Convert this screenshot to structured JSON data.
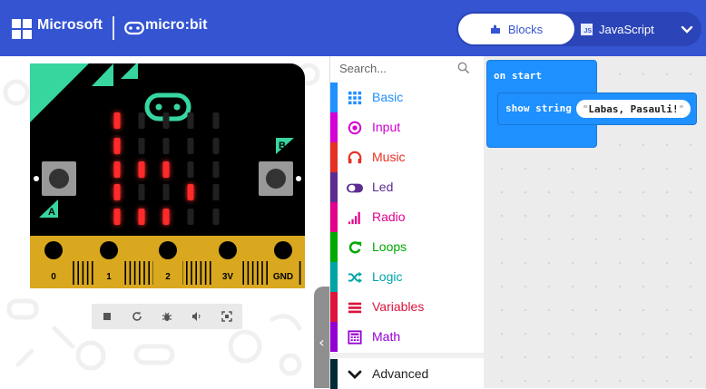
{
  "header": {
    "brand": "Microsoft",
    "product": "micro:bit",
    "tabs": {
      "blocks": "Blocks",
      "javascript": "JavaScript"
    },
    "colors": {
      "bar": "#3454d1"
    }
  },
  "simulator": {
    "pins": [
      "0",
      "1",
      "2",
      "3V",
      "GND"
    ],
    "button_a": "A",
    "button_b": "B",
    "led_rows": [
      [
        1,
        0,
        0,
        0,
        0
      ],
      [
        1,
        0,
        0,
        0,
        0
      ],
      [
        1,
        1,
        1,
        0,
        0
      ],
      [
        1,
        0,
        0,
        1,
        0
      ],
      [
        1,
        1,
        1,
        0,
        0
      ]
    ],
    "toolbar_icons": [
      "stop-icon",
      "restart-icon",
      "debug-icon",
      "sound-icon",
      "fullscreen-icon"
    ]
  },
  "toolbox": {
    "search_placeholder": "Search...",
    "categories": [
      {
        "label": "Basic",
        "color": "#1e90ff",
        "icon": "grid-icon"
      },
      {
        "label": "Input",
        "color": "#d400d4",
        "icon": "target-icon"
      },
      {
        "label": "Music",
        "color": "#e63022",
        "icon": "headphones-icon"
      },
      {
        "label": "Led",
        "color": "#5c2d91",
        "icon": "toggle-icon"
      },
      {
        "label": "Radio",
        "color": "#e3008c",
        "icon": "signal-icon"
      },
      {
        "label": "Loops",
        "color": "#00aa00",
        "icon": "loop-icon"
      },
      {
        "label": "Logic",
        "color": "#00a4a6",
        "icon": "shuffle-icon"
      },
      {
        "label": "Variables",
        "color": "#dc143c",
        "icon": "lines-icon"
      },
      {
        "label": "Math",
        "color": "#9400d3",
        "icon": "calculator-icon"
      }
    ],
    "advanced": {
      "label": "Advanced",
      "color": "#002b36"
    }
  },
  "workspace": {
    "event_block": "on start",
    "statement_block": "show string",
    "string_value": "Labas, Pasauli!",
    "block_color": "#1e90ff"
  }
}
